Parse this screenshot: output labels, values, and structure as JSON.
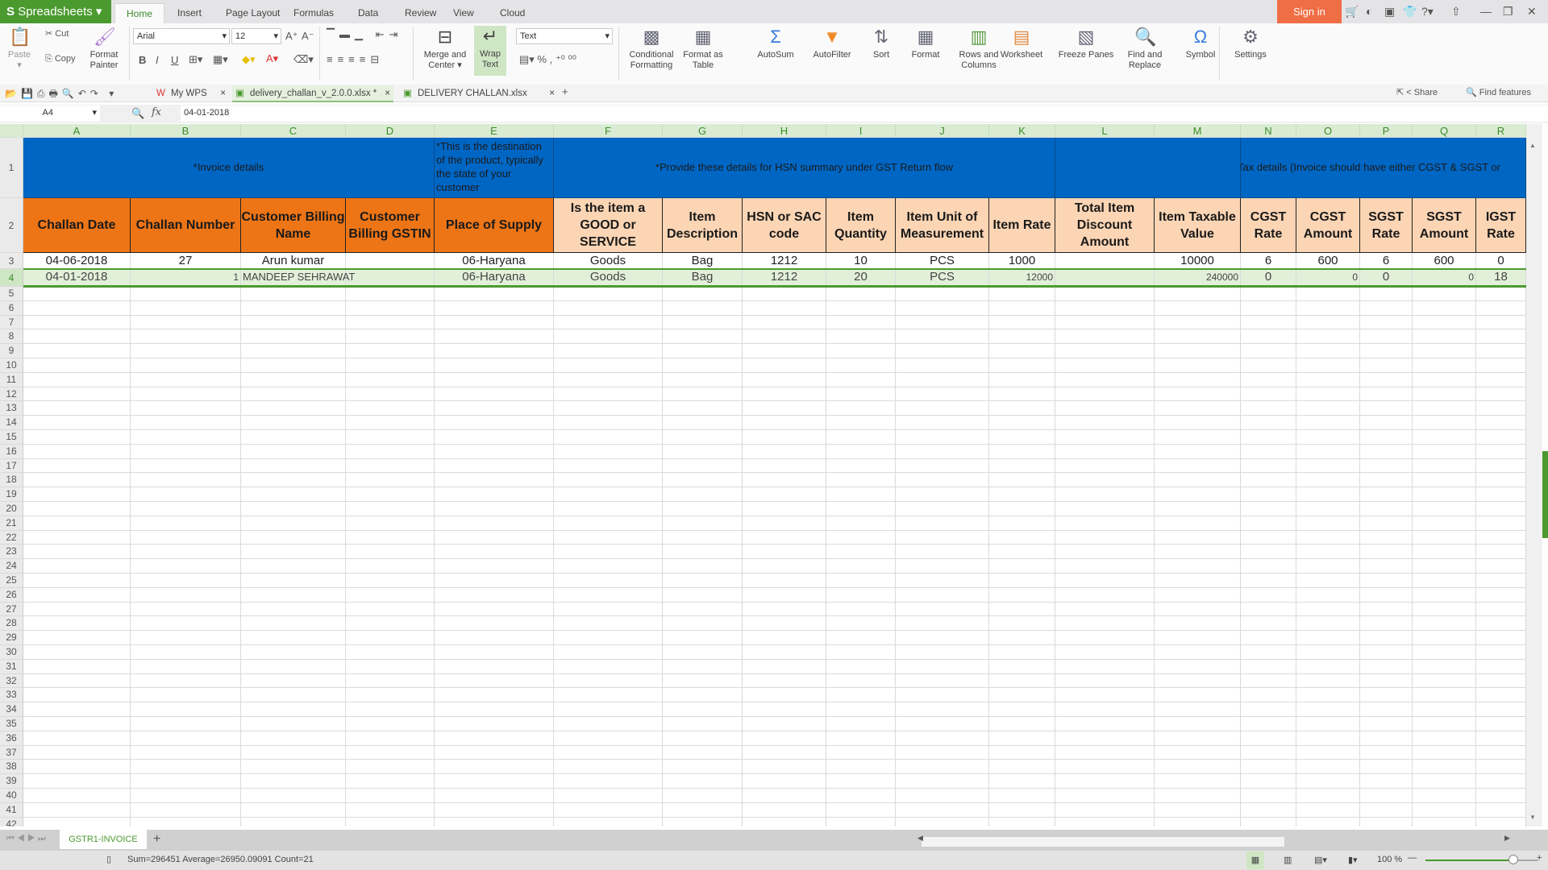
{
  "app": {
    "name": "Spreadsheets",
    "menu_tabs": [
      "Home",
      "Insert",
      "Page Layout",
      "Formulas",
      "Data",
      "Review",
      "View",
      "Cloud"
    ],
    "active_tab": "Home",
    "sign_in": "Sign in"
  },
  "ribbon": {
    "paste": "Paste",
    "cut": "Cut",
    "copy": "Copy",
    "format_painter": "Format Painter",
    "font": "Arial",
    "font_size": "12",
    "number_format": "Text",
    "bold": "B",
    "italic": "I",
    "underline": "U",
    "merge_center": "Merge and Center",
    "wrap_text": "Wrap Text",
    "buttons": [
      {
        "label": "Conditional Formatting",
        "icon": "conditional-formatting-icon"
      },
      {
        "label": "Format as Table",
        "icon": "format-table-icon"
      },
      {
        "label": "AutoSum",
        "icon": "sigma-icon"
      },
      {
        "label": "AutoFilter",
        "icon": "filter-icon"
      },
      {
        "label": "Sort",
        "icon": "sort-icon"
      },
      {
        "label": "Format",
        "icon": "format-icon"
      },
      {
        "label": "Rows and Columns",
        "icon": "rows-columns-icon"
      },
      {
        "label": "Worksheet",
        "icon": "worksheet-icon"
      },
      {
        "label": "Freeze Panes",
        "icon": "freeze-panes-icon"
      },
      {
        "label": "Find and Replace",
        "icon": "find-replace-icon"
      },
      {
        "label": "Symbol",
        "icon": "omega-icon"
      },
      {
        "label": "Settings",
        "icon": "settings-icon"
      }
    ]
  },
  "doc_tabs": [
    {
      "label": "My WPS",
      "active": false
    },
    {
      "label": "delivery_challan_v_2.0.0.xlsx *",
      "active": true
    },
    {
      "label": "DELIVERY CHALLAN.xlsx",
      "active": false
    }
  ],
  "share": "Share",
  "find_features": "Find features",
  "formula_bar": {
    "name_box": "A4",
    "fx": "fx",
    "value": "04-01-2018"
  },
  "columns": [
    "A",
    "B",
    "C",
    "D",
    "E",
    "F",
    "G",
    "H",
    "I",
    "J",
    "K",
    "L",
    "M",
    "N",
    "O",
    "P",
    "Q",
    "R"
  ],
  "row1": {
    "invoice_details": "*Invoice details",
    "destination_note": "*This is the destination of the product, typically the state of your customer",
    "hsn_note": "*Provide these details for HSN summary under GST Return flow",
    "tax_note": "Tax details (Invoice should have either CGST & SGST or"
  },
  "headers": [
    "Challan Date",
    "Challan Number",
    "Customer Billing Name",
    "Customer Billing GSTIN",
    "Place of Supply",
    "Is the item a GOOD or SERVICE",
    "Item Description",
    "HSN or SAC code",
    "Item Quantity",
    "Item Unit of Measurement",
    "Item Rate",
    "Total Item Discount Amount",
    "Item Taxable Value",
    "CGST Rate",
    "CGST Amount",
    "SGST Rate",
    "SGST Amount",
    "IGST Rate"
  ],
  "rows": [
    [
      "04-06-2018",
      "27",
      "Arun kumar",
      "",
      "06-Haryana",
      "Goods",
      "Bag",
      "1212",
      "10",
      "PCS",
      "1000",
      "",
      "10000",
      "6",
      "600",
      "6",
      "600",
      "0"
    ],
    [
      "04-01-2018",
      "1",
      "MANDEEP SEHRAWAT",
      "",
      "06-Haryana",
      "Goods",
      "Bag",
      "1212",
      "20",
      "PCS",
      "12000",
      "",
      "240000",
      "0",
      "0",
      "0",
      "0",
      "18"
    ]
  ],
  "selected_row": 4,
  "last_visible_row": 42,
  "sheet_tabs": [
    "GSTR1-INVOICE"
  ],
  "status": {
    "summary": "Sum=296451  Average=26950.09091  Count=21",
    "zoom": "100 %",
    "zoom_level": 100
  },
  "colors": {
    "brand": "#4b9a2f",
    "sign_in": "#ef6e44",
    "header_blue": "#0066c4",
    "header_orange": "#ee7516",
    "header_peach": "#fcd5b4"
  }
}
